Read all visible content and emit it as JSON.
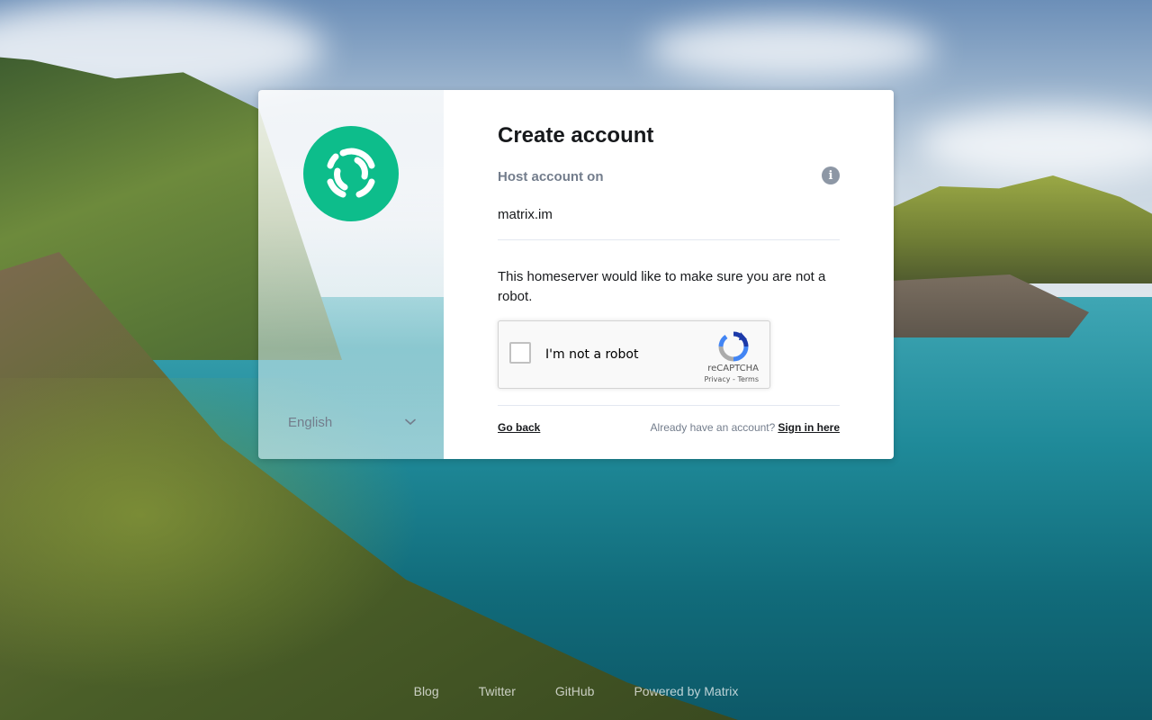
{
  "dialog": {
    "title": "Create account",
    "host_label": "Host account on",
    "host_value": "matrix.im",
    "robot_text": "This homeserver would like to make sure you are not a robot.",
    "captcha": {
      "label": "I'm not a robot",
      "brand": "reCAPTCHA",
      "privacy": "Privacy",
      "separator": " - ",
      "terms": "Terms"
    },
    "go_back": "Go back",
    "have_account": "Already have an account?",
    "sign_in": "Sign in here"
  },
  "sidebar": {
    "language": "English"
  },
  "footer": {
    "links": [
      "Blog",
      "Twitter",
      "GitHub",
      "Powered by Matrix"
    ]
  },
  "colors": {
    "accent": "#0dbd8b",
    "text_primary": "#17191c",
    "text_secondary": "#737d8c"
  },
  "icons": [
    "element-logo-icon",
    "info-icon",
    "chevron-down-icon",
    "recaptcha-logo-icon",
    "checkbox-icon"
  ]
}
